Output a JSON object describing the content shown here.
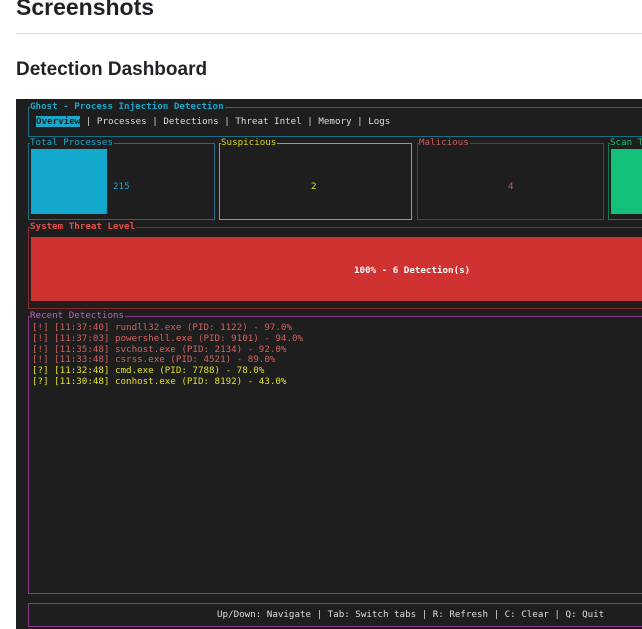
{
  "page": {
    "heading": "Screenshots",
    "subheading": "Detection Dashboard"
  },
  "app": {
    "title": "Ghost - Process Injection Detection",
    "tabs": [
      {
        "label": "Overview",
        "active": true
      },
      {
        "label": "Processes"
      },
      {
        "label": "Detections"
      },
      {
        "label": "Threat Intel"
      },
      {
        "label": "Memory"
      },
      {
        "label": "Logs"
      }
    ],
    "separator": "|"
  },
  "stats": {
    "total": {
      "title": "Total Processes",
      "value": "215",
      "color": "#12a9cc"
    },
    "suspicious": {
      "title": "Suspicious",
      "value": "2",
      "color": "#c8c820"
    },
    "malicious": {
      "title": "Malicious",
      "value": "4",
      "color": "#d04848"
    },
    "scan": {
      "title": "Scan T",
      "color": "#12c07a"
    }
  },
  "threat": {
    "title": "System Threat Level",
    "percent": 100,
    "label": "100% - 6 Detection(s)",
    "color": "#d03232"
  },
  "recent": {
    "title": "Recent Detections",
    "items": [
      {
        "text": "[!] [11:37:40] rundll32.exe (PID: 1122) - 97.0%",
        "level": "mal"
      },
      {
        "text": "[!] [11:37:03] powershell.exe (PID: 9101) - 94.0%",
        "level": "mal"
      },
      {
        "text": "[!] [11:35:48] svchost.exe (PID: 2134) - 92.0%",
        "level": "mal"
      },
      {
        "text": "[!] [11:33:48] csrss.exe (PID: 4521) - 89.0%",
        "level": "mal"
      },
      {
        "text": "[?] [11:32:48] cmd.exe (PID: 7788) - 78.0%",
        "level": "sus"
      },
      {
        "text": "[?] [11:30:48] conhost.exe (PID: 8192) - 43.0%",
        "level": "sus"
      }
    ]
  },
  "footer": {
    "help": "Up/Down: Navigate | Tab: Switch tabs | R: Refresh | C: Clear | Q: Quit"
  }
}
